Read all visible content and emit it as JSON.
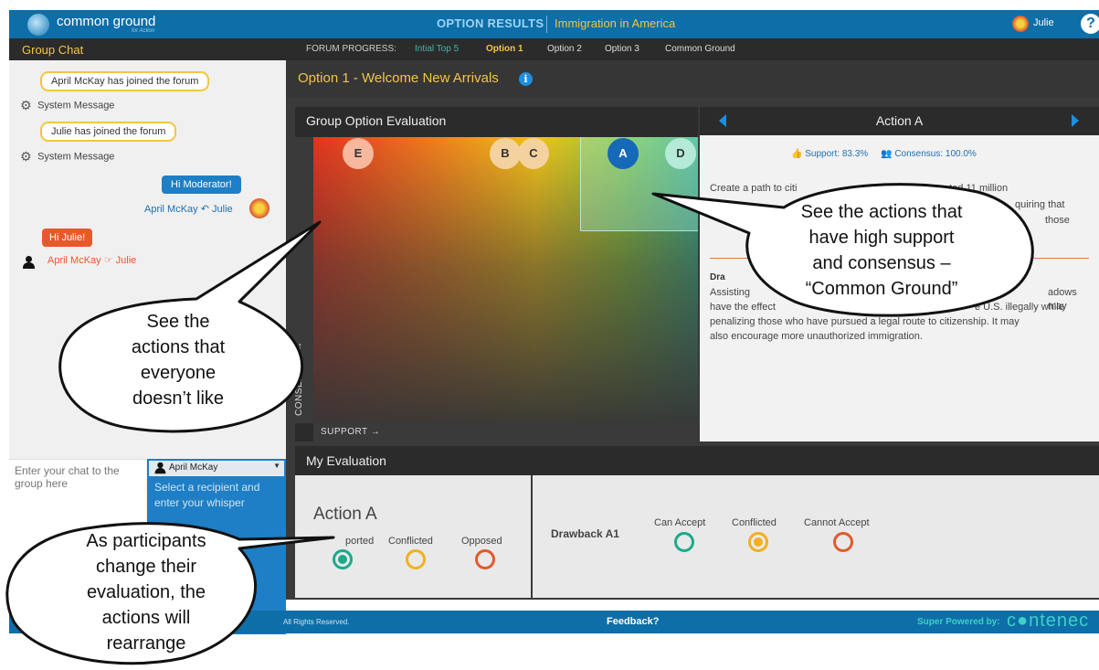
{
  "topbar": {
    "app_name": "common ground",
    "app_sub": "for Action",
    "page_label": "OPTION RESULTS",
    "forum_title": "Immigration in America",
    "user": "Julie",
    "help": "?"
  },
  "chat": {
    "header": "Group Chat",
    "messages": [
      {
        "type": "system",
        "bubble": "April McKay has joined the forum",
        "sender": "System Message"
      },
      {
        "type": "system",
        "bubble": "Julie has joined the forum",
        "sender": "System Message"
      },
      {
        "type": "whisper_out",
        "bubble": "Hi Moderator!",
        "line": "April McKay ↶ Julie"
      },
      {
        "type": "whisper_in",
        "bubble": "Hi Julie!",
        "line": "April McKay ☞ Julie"
      }
    ],
    "input_placeholder": "Enter your chat to the group here",
    "recipient": "April McKay",
    "recipient_hint": "Select a recipient and enter your whisper"
  },
  "progress": {
    "label": "FORUM PROGRESS:",
    "steps": [
      "Intial Top 5",
      "Option 1",
      "Option 2",
      "Option 3",
      "Common Ground"
    ],
    "active_index": 1
  },
  "option": {
    "title": "Option 1 - Welcome New Arrivals",
    "info_icon": "i"
  },
  "group_eval": {
    "header": "Group Option Evaluation",
    "y_label": "CONSENSUS →",
    "x_label": "SUPPORT →",
    "actions": [
      {
        "label": "E",
        "color": "#f6b99d",
        "text": "dark"
      },
      {
        "label": "B",
        "color": "#f4d2a0",
        "text": "dark"
      },
      {
        "label": "C",
        "color": "#f4d2a0",
        "text": "dark"
      },
      {
        "label": "A",
        "color": "#1668b8",
        "text": "light"
      },
      {
        "label": "D",
        "color": "#b4ead7",
        "text": "dark"
      }
    ]
  },
  "action_panel": {
    "title": "Action A",
    "support": "Support: 83.3%",
    "consensus": "Consensus: 100.0%",
    "text1": "Create a path to citi",
    "text1b": "ated 11 million",
    "text2": "quiring that",
    "text3": "those",
    "drawback_label": "Dra",
    "drawback1": "Assisting",
    "drawback1b": "adows may",
    "drawback2": "have the effect",
    "drawback2b": "e U.S. illegally while",
    "drawback3": "penalizing those who have pursued a legal route to citizenship. It may",
    "drawback4": "also encourage more unauthorized immigration."
  },
  "my_eval": {
    "header": "My Evaluation",
    "action_title": "Action A",
    "action_options": [
      "ported",
      "Conflicted",
      "Opposed"
    ],
    "drawback_title": "Drawback A1",
    "drawback_options": [
      "Can Accept",
      "Conflicted",
      "Cannot Accept"
    ]
  },
  "footer": {
    "rights": "All Rights Reserved.",
    "feedback": "Feedback?",
    "powered": "Super Powered by:",
    "brand": "c●ntenec"
  },
  "callouts": {
    "left": [
      "See the",
      "actions that",
      "everyone",
      "doesn’t like"
    ],
    "right": [
      "See the actions that",
      "have high support",
      "and consensus –",
      "“Common Ground”"
    ],
    "bottom": [
      "As participants",
      "change their",
      "evaluation, the",
      "actions will",
      "rearrange"
    ]
  },
  "colors": {
    "brand_blue": "#0d6ea8",
    "accent_yellow": "#f4c542",
    "teal": "#1aaa8e",
    "amber": "#f2b01e",
    "orange_red": "#e35a2c"
  }
}
